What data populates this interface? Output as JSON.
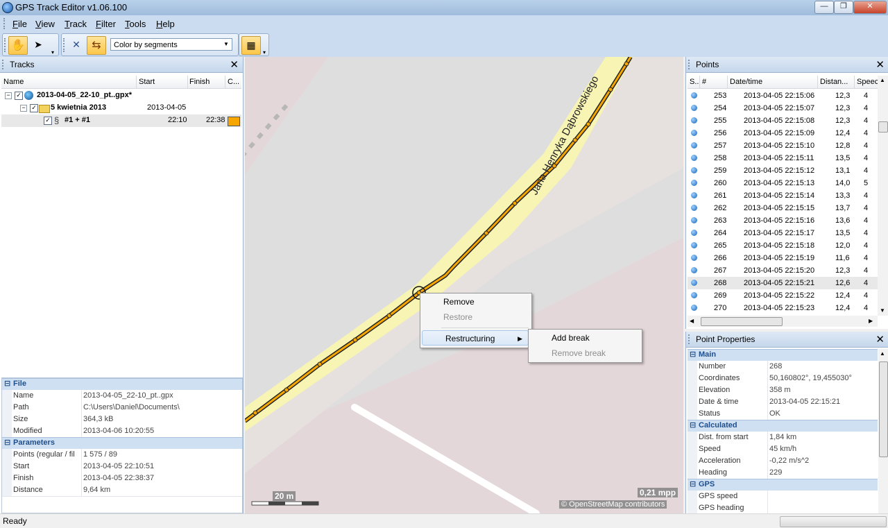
{
  "window": {
    "title": "GPS Track Editor v1.06.100",
    "minimize": "—",
    "maximize": "❐",
    "close": "✕"
  },
  "menu": [
    "File",
    "View",
    "Track",
    "Filter",
    "Tools",
    "Help"
  ],
  "toolbar": {
    "color_mode": "Color by segments"
  },
  "tracks": {
    "title": "Tracks",
    "columns": [
      "Name",
      "Start",
      "Finish",
      "C..."
    ],
    "file": {
      "name": "2013-04-05_22-10_pt..gpx*"
    },
    "folder": {
      "name": "5 kwietnia 2013",
      "start": "2013-04-05"
    },
    "segment": {
      "name": "#1 + #1",
      "start": "22:10",
      "finish": "22:38",
      "color": "#f7a600"
    }
  },
  "file_props": {
    "categories": [
      {
        "title": "File",
        "rows": [
          {
            "name": "Name",
            "value": "2013-04-05_22-10_pt..gpx"
          },
          {
            "name": "Path",
            "value": "C:\\Users\\Daniel\\Documents\\"
          },
          {
            "name": "Size",
            "value": "364,3 kB"
          },
          {
            "name": "Modified",
            "value": "2013-04-06 10:20:55"
          }
        ]
      },
      {
        "title": "Parameters",
        "rows": [
          {
            "name": "Points (regular / fil",
            "value": "1 575 / 89"
          },
          {
            "name": "Start",
            "value": "2013-04-05 22:10:51"
          },
          {
            "name": "Finish",
            "value": "2013-04-05 22:38:37"
          },
          {
            "name": "Distance",
            "value": "9,64 km"
          }
        ]
      }
    ]
  },
  "map": {
    "street_label": "Jana Henryka Dąbrowskiego",
    "scale_label": "20 m",
    "mpp_label": "0,21 mpp",
    "attribution": "© OpenStreetMap contributors"
  },
  "context_menu": {
    "items": [
      "Remove",
      "Restore",
      "Restructuring"
    ],
    "submenu": [
      "Add break",
      "Remove break"
    ]
  },
  "points": {
    "title": "Points",
    "columns": [
      "S...",
      "#",
      "Date/time",
      "Distan...",
      "Speec"
    ],
    "rows": [
      {
        "n": "253",
        "dt": "2013-04-05  22:15:06",
        "dist": "12,3",
        "speed": "4"
      },
      {
        "n": "254",
        "dt": "2013-04-05  22:15:07",
        "dist": "12,3",
        "speed": "4"
      },
      {
        "n": "255",
        "dt": "2013-04-05  22:15:08",
        "dist": "12,3",
        "speed": "4"
      },
      {
        "n": "256",
        "dt": "2013-04-05  22:15:09",
        "dist": "12,4",
        "speed": "4"
      },
      {
        "n": "257",
        "dt": "2013-04-05  22:15:10",
        "dist": "12,8",
        "speed": "4"
      },
      {
        "n": "258",
        "dt": "2013-04-05  22:15:11",
        "dist": "13,5",
        "speed": "4"
      },
      {
        "n": "259",
        "dt": "2013-04-05  22:15:12",
        "dist": "13,1",
        "speed": "4"
      },
      {
        "n": "260",
        "dt": "2013-04-05  22:15:13",
        "dist": "14,0",
        "speed": "5"
      },
      {
        "n": "261",
        "dt": "2013-04-05  22:15:14",
        "dist": "13,3",
        "speed": "4"
      },
      {
        "n": "262",
        "dt": "2013-04-05  22:15:15",
        "dist": "13,7",
        "speed": "4"
      },
      {
        "n": "263",
        "dt": "2013-04-05  22:15:16",
        "dist": "13,6",
        "speed": "4"
      },
      {
        "n": "264",
        "dt": "2013-04-05  22:15:17",
        "dist": "13,5",
        "speed": "4"
      },
      {
        "n": "265",
        "dt": "2013-04-05  22:15:18",
        "dist": "12,0",
        "speed": "4"
      },
      {
        "n": "266",
        "dt": "2013-04-05  22:15:19",
        "dist": "11,6",
        "speed": "4"
      },
      {
        "n": "267",
        "dt": "2013-04-05  22:15:20",
        "dist": "12,3",
        "speed": "4"
      },
      {
        "n": "268",
        "dt": "2013-04-05  22:15:21",
        "dist": "12,6",
        "speed": "4",
        "selected": true
      },
      {
        "n": "269",
        "dt": "2013-04-05  22:15:22",
        "dist": "12,4",
        "speed": "4"
      },
      {
        "n": "270",
        "dt": "2013-04-05  22:15:23",
        "dist": "12,4",
        "speed": "4"
      }
    ]
  },
  "point_props": {
    "title": "Point Properties",
    "categories": [
      {
        "title": "Main",
        "rows": [
          {
            "name": "Number",
            "value": "268"
          },
          {
            "name": "Coordinates",
            "value": "50,160802°, 19,455030°"
          },
          {
            "name": "Elevation",
            "value": "358 m"
          },
          {
            "name": "Date & time",
            "value": "2013-04-05 22:15:21"
          },
          {
            "name": "Status",
            "value": "OK"
          }
        ]
      },
      {
        "title": "Calculated",
        "rows": [
          {
            "name": "Dist. from start",
            "value": "1,84 km"
          },
          {
            "name": "Speed",
            "value": "45 km/h"
          },
          {
            "name": "Acceleration",
            "value": "-0,22 m/s^2"
          },
          {
            "name": "Heading",
            "value": "229"
          }
        ]
      },
      {
        "title": "GPS",
        "rows": [
          {
            "name": "GPS speed",
            "value": ""
          },
          {
            "name": "GPS heading",
            "value": ""
          }
        ]
      }
    ]
  },
  "status": {
    "text": "Ready"
  }
}
